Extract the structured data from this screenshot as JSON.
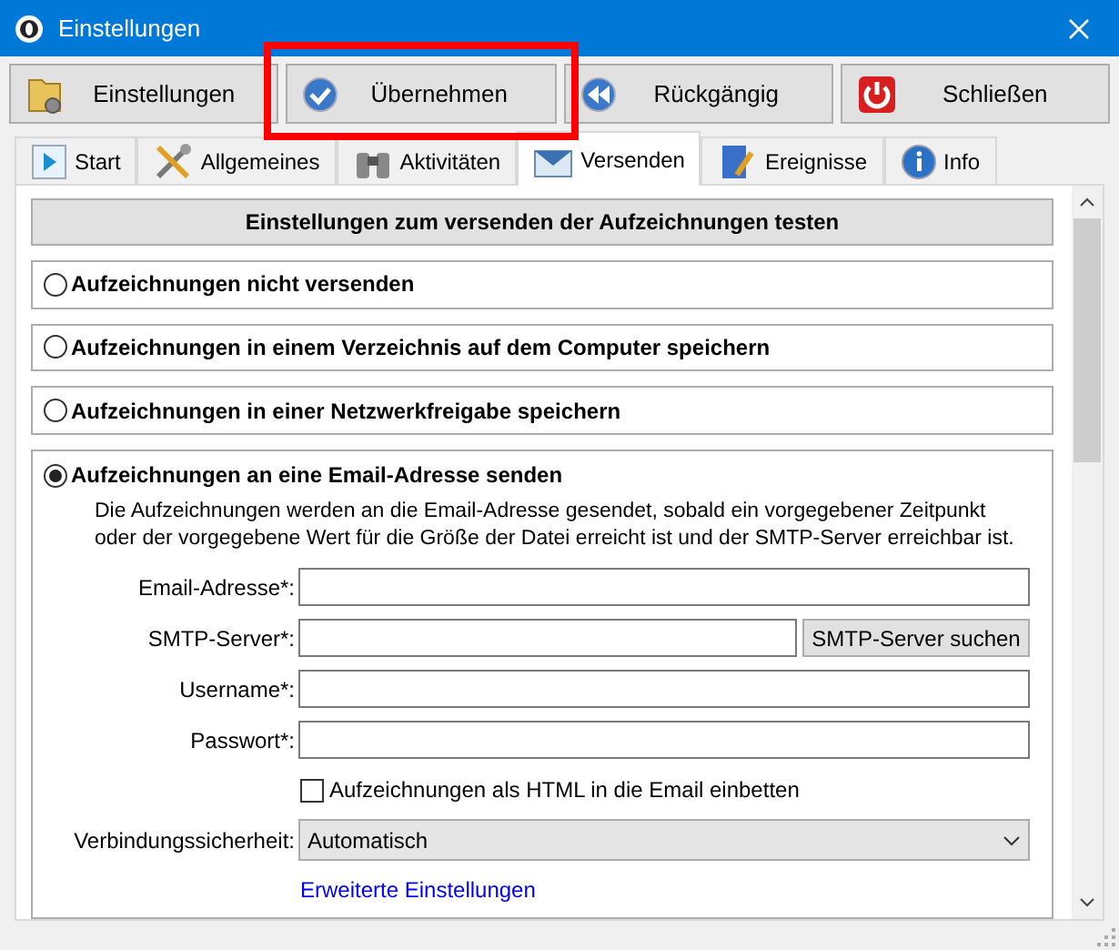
{
  "window": {
    "title": "Einstellungen"
  },
  "toolbar": [
    {
      "label": "Einstellungen",
      "kind": "folder",
      "highlighted": false
    },
    {
      "label": "Übernehmen",
      "kind": "apply",
      "highlighted": true
    },
    {
      "label": "Rückgängig",
      "kind": "undo",
      "highlighted": false
    },
    {
      "label": "Schließen",
      "kind": "power",
      "highlighted": false
    }
  ],
  "tabs": [
    {
      "label": "Start",
      "kind": "play",
      "selected": false
    },
    {
      "label": "Allgemeines",
      "kind": "tools",
      "selected": false
    },
    {
      "label": "Aktivitäten",
      "kind": "binoculars",
      "selected": false
    },
    {
      "label": "Versenden",
      "kind": "mail",
      "selected": true
    },
    {
      "label": "Ereignisse",
      "kind": "document",
      "selected": false
    },
    {
      "label": "Info",
      "kind": "info",
      "selected": false
    }
  ],
  "test_button": "Einstellungen zum versenden der Aufzeichnungen testen",
  "options": [
    {
      "label": "Aufzeichnungen nicht versenden",
      "selected": false
    },
    {
      "label": "Aufzeichnungen in einem Verzeichnis auf dem Computer speichern",
      "selected": false
    },
    {
      "label": "Aufzeichnungen in einer Netzwerkfreigabe speichern",
      "selected": false
    },
    {
      "label": "Aufzeichnungen an eine Email-Adresse senden",
      "selected": true
    }
  ],
  "email_form": {
    "description": "Die Aufzeichnungen werden an die Email-Adresse gesendet, sobald ein vorgegebener Zeitpunkt oder der vorgegebene Wert für die Größe der Datei erreicht ist und der SMTP-Server erreichbar ist.",
    "fields": [
      {
        "label": "Email-Adresse*:"
      },
      {
        "label": "SMTP-Server*:",
        "button": "SMTP-Server suchen"
      },
      {
        "label": "Username*:"
      },
      {
        "label": "Passwort*:"
      }
    ],
    "checkbox": {
      "label": "Aufzeichnungen als HTML in die Email einbetten",
      "checked": false
    },
    "security": {
      "label": "Verbindungssicherheit:",
      "value": "Automatisch"
    },
    "link": "Erweiterte Einstellungen"
  }
}
